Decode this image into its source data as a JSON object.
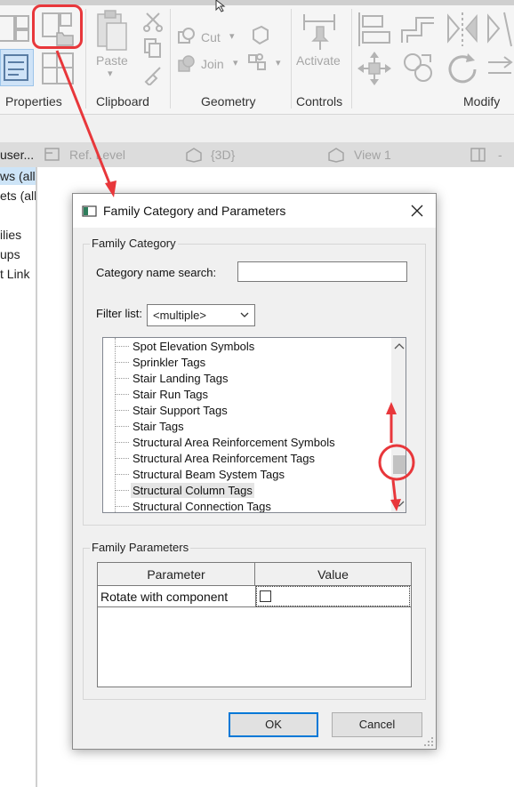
{
  "ribbon": {
    "groups": [
      {
        "label": "Properties"
      },
      {
        "label": "Clipboard"
      },
      {
        "label": "Geometry"
      },
      {
        "label": "Controls"
      },
      {
        "label": "Modify"
      }
    ],
    "clipboard": {
      "paste_label": "Paste"
    },
    "geometry": {
      "cut_label": "Cut",
      "join_label": "Join"
    },
    "controls": {
      "activate_label": "Activate"
    }
  },
  "view_tabs": [
    {
      "label": "Ref. Level"
    },
    {
      "label": "{3D}"
    },
    {
      "label": "View 1"
    }
  ],
  "browser_fragments": [
    "user...",
    "ws (all",
    "ets (all",
    "ilies",
    "ups",
    "t Link"
  ],
  "dialog": {
    "title": "Family Category and Parameters",
    "family_category": {
      "group_title": "Family Category",
      "search_label": "Category name search:",
      "search_value": "",
      "filter_label": "Filter list:",
      "filter_value": "<multiple>",
      "items": [
        "Spot Elevation Symbols",
        "Sprinkler Tags",
        "Stair Landing Tags",
        "Stair Run Tags",
        "Stair Support Tags",
        "Stair Tags",
        "Structural Area Reinforcement Symbols",
        "Structural Area Reinforcement Tags",
        "Structural Beam System Tags",
        "Structural Column Tags",
        "Structural Connection Tags"
      ],
      "selected_item": "Structural Column Tags"
    },
    "family_parameters": {
      "group_title": "Family Parameters",
      "columns": [
        "Parameter",
        "Value"
      ],
      "rows": [
        {
          "parameter": "Rotate with component",
          "value_checked": false
        }
      ]
    },
    "buttons": {
      "ok": "OK",
      "cancel": "Cancel"
    }
  },
  "annotations": {
    "color": "#e8373b"
  }
}
